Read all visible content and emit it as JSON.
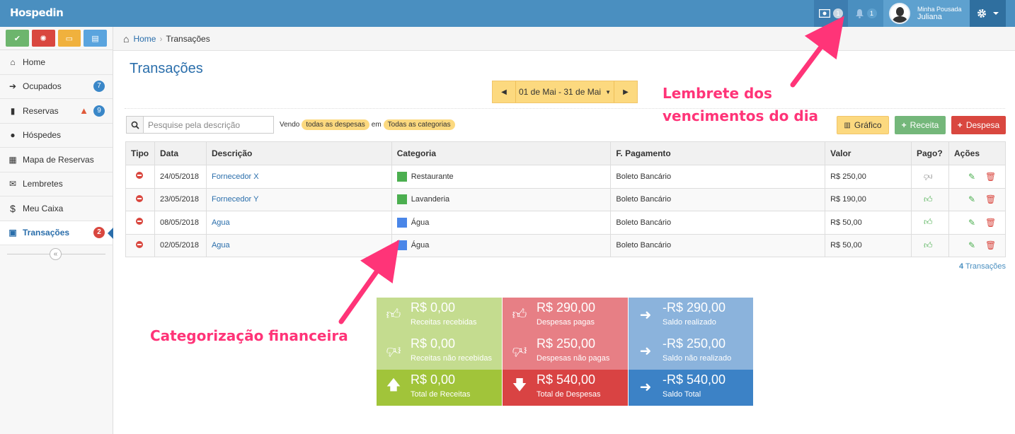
{
  "topbar": {
    "logo": "Hospedin",
    "money_badge": "1",
    "bell_badge": "1",
    "user_org": "Minha Pousada",
    "user_name": "Juliana"
  },
  "sidebar": {
    "items": [
      {
        "label": "Home",
        "icon": "home-icon",
        "badge": ""
      },
      {
        "label": "Ocupados",
        "icon": "sign-in-icon",
        "badge": "7"
      },
      {
        "label": "Reservas",
        "icon": "book-icon",
        "badge": "9"
      },
      {
        "label": "Hóspedes",
        "icon": "users-icon",
        "badge": ""
      },
      {
        "label": "Mapa de Reservas",
        "icon": "calendar-icon",
        "badge": ""
      },
      {
        "label": "Lembretes",
        "icon": "envelope-icon",
        "badge": ""
      },
      {
        "label": "Meu Caixa",
        "icon": "dollar-icon",
        "badge": ""
      },
      {
        "label": "Transações",
        "icon": "money-icon",
        "badge": "2"
      }
    ],
    "shortcut_colors": [
      "#6db56d",
      "#d9473f",
      "#f0b13d",
      "#5aa4de"
    ]
  },
  "breadcrumb": {
    "home": "Home",
    "current": "Transações"
  },
  "page": {
    "title": "Transações",
    "date_range": "01 de Mai - 31 de Mai",
    "search_placeholder": "Pesquise pela descrição",
    "filter_vendo": "Vendo",
    "filter_tipo": "todas as despesas",
    "filter_em": "em",
    "filter_categoria": "Todas as categorias",
    "btn_grafico": "Gráfico",
    "btn_receita": "Receita",
    "btn_despesa": "Despesa"
  },
  "table": {
    "headers": [
      "Tipo",
      "Data",
      "Descrição",
      "Categoria",
      "F. Pagamento",
      "Valor",
      "Pago?",
      "Ações"
    ],
    "rows": [
      {
        "data": "24/05/2018",
        "descricao": "Fornecedor X",
        "categoria": "Restaurante",
        "cat_color": "#4caf50",
        "pagamento": "Boleto Bancário",
        "valor": "R$ 250,00",
        "pago": false
      },
      {
        "data": "23/05/2018",
        "descricao": "Fornecedor Y",
        "categoria": "Lavanderia",
        "cat_color": "#4caf50",
        "pagamento": "Boleto Bancário",
        "valor": "R$ 190,00",
        "pago": true
      },
      {
        "data": "08/05/2018",
        "descricao": "Agua",
        "categoria": "Água",
        "cat_color": "#4a86e8",
        "pagamento": "Boleto Bancário",
        "valor": "R$ 50,00",
        "pago": true
      },
      {
        "data": "02/05/2018",
        "descricao": "Agua",
        "categoria": "Água",
        "cat_color": "#4a86e8",
        "pagamento": "Boleto Bancário",
        "valor": "R$ 50,00",
        "pago": true
      }
    ],
    "count_number": "4",
    "count_label": "Transações"
  },
  "summary": [
    {
      "value": "R$ 0,00",
      "label": "Receitas recebidas",
      "icon": "thumbs-up-icon",
      "color": "#c4dc8f"
    },
    {
      "value": "R$ 290,00",
      "label": "Despesas pagas",
      "icon": "thumbs-up-icon",
      "color": "#e77f85"
    },
    {
      "value": "-R$ 290,00",
      "label": "Saldo realizado",
      "icon": "arrow-right-icon",
      "color": "#8bb3dc"
    },
    {
      "value": "R$ 0,00",
      "label": "Receitas não recebidas",
      "icon": "thumbs-down-icon",
      "color": "#c4dc8f"
    },
    {
      "value": "R$ 250,00",
      "label": "Despesas não pagas",
      "icon": "thumbs-down-icon",
      "color": "#e77f85"
    },
    {
      "value": "-R$ 250,00",
      "label": "Saldo não realizado",
      "icon": "arrow-right-icon",
      "color": "#8bb3dc"
    },
    {
      "value": "R$ 0,00",
      "label": "Total de Receitas",
      "icon": "arrow-up-icon",
      "color": "#a1c43a"
    },
    {
      "value": "R$ 540,00",
      "label": "Total de Despesas",
      "icon": "arrow-down-icon",
      "color": "#d94343"
    },
    {
      "value": "-R$ 540,00",
      "label": "Saldo Total",
      "icon": "arrow-right-icon",
      "color": "#3c82c6"
    }
  ],
  "annotations": {
    "top_line1": "Lembrete dos",
    "top_line2": "vencimentos do dia",
    "bottom": "Categorização financeira",
    "color": "#ff3478"
  }
}
